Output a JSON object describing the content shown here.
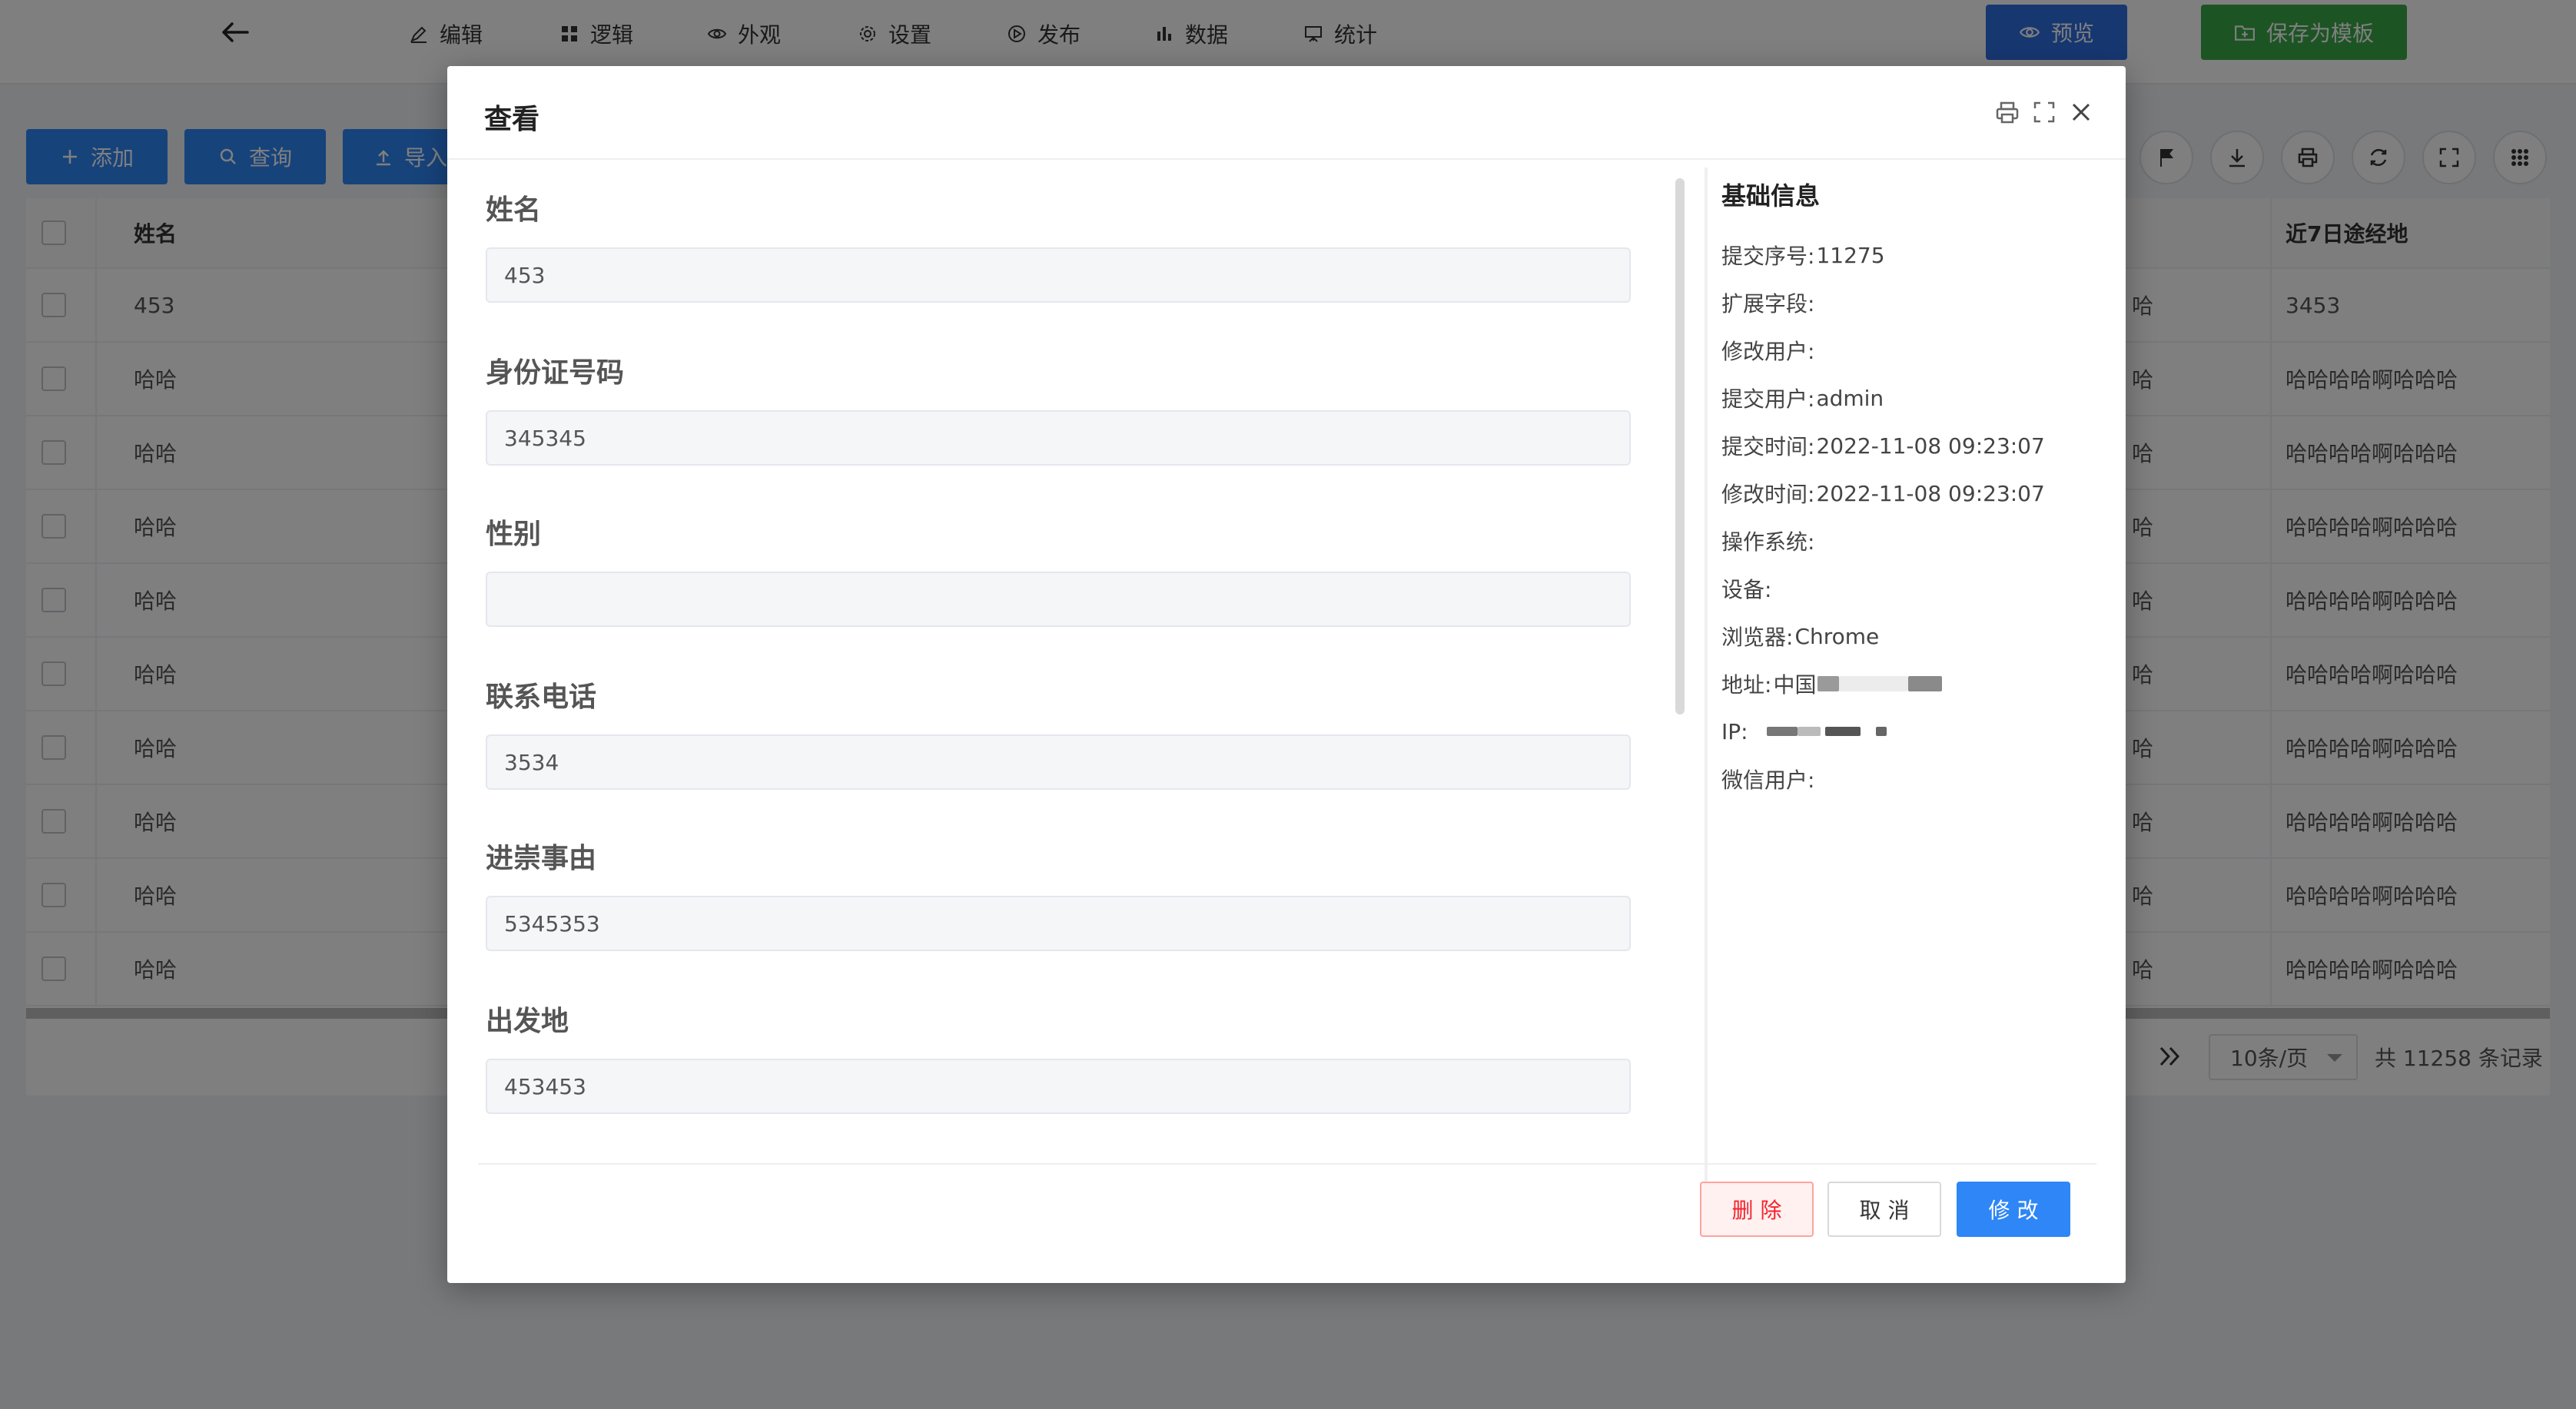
{
  "header": {
    "nav": [
      {
        "label": "编辑",
        "icon": "edit-icon"
      },
      {
        "label": "逻辑",
        "icon": "grid-icon"
      },
      {
        "label": "外观",
        "icon": "eye-icon"
      },
      {
        "label": "设置",
        "icon": "gear-icon"
      },
      {
        "label": "发布",
        "icon": "play-circle-icon"
      },
      {
        "label": "数据",
        "icon": "bar-chart-icon"
      },
      {
        "label": "统计",
        "icon": "board-icon"
      }
    ],
    "preview_label": "预览",
    "save_template_label": "保存为模板"
  },
  "list": {
    "add_label": "添加",
    "query_label": "查询",
    "import_label": "导入",
    "columns": {
      "name": "姓名",
      "last": "近7日途经地"
    },
    "rows": [
      {
        "name": "453",
        "last": "3453"
      },
      {
        "name": "哈哈",
        "last": "哈哈哈哈啊哈哈哈"
      },
      {
        "name": "哈哈",
        "last": "哈哈哈哈啊哈哈哈"
      },
      {
        "name": "哈哈",
        "last": "哈哈哈哈啊哈哈哈"
      },
      {
        "name": "哈哈",
        "last": "哈哈哈哈啊哈哈哈"
      },
      {
        "name": "哈哈",
        "last": "哈哈哈哈啊哈哈哈"
      },
      {
        "name": "哈哈",
        "last": "哈哈哈哈啊哈哈哈"
      },
      {
        "name": "哈哈",
        "last": "哈哈哈哈啊哈哈哈"
      },
      {
        "name": "哈哈",
        "last": "哈哈哈哈啊哈哈哈"
      },
      {
        "name": "哈哈",
        "last": "哈哈哈哈啊哈哈哈"
      }
    ],
    "partial_col_text": "哈",
    "page_size": "10条/页",
    "total": "共 11258 条记录"
  },
  "modal": {
    "title": "查看",
    "fields": [
      {
        "label": "姓名",
        "value": "453"
      },
      {
        "label": "身份证号码",
        "value": "345345"
      },
      {
        "label": "性别",
        "value": ""
      },
      {
        "label": "联系电话",
        "value": "3534"
      },
      {
        "label": "进崇事由",
        "value": "5345353"
      },
      {
        "label": "出发地",
        "value": "453453"
      }
    ],
    "info": {
      "title": "基础信息",
      "rows": [
        {
          "label": "提交序号:",
          "value": "11275"
        },
        {
          "label": "扩展字段:",
          "value": ""
        },
        {
          "label": "修改用户:",
          "value": ""
        },
        {
          "label": "提交用户:",
          "value": "admin"
        },
        {
          "label": "提交时间:",
          "value": "2022-11-08 09:23:07"
        },
        {
          "label": "修改时间:",
          "value": "2022-11-08 09:23:07"
        },
        {
          "label": "操作系统:",
          "value": ""
        },
        {
          "label": "设备:",
          "value": ""
        },
        {
          "label": "浏览器:",
          "value": "Chrome"
        },
        {
          "label": "地址:",
          "value": "中国"
        },
        {
          "label": "IP:",
          "value": ""
        },
        {
          "label": "微信用户:",
          "value": ""
        }
      ]
    },
    "delete_label": "删 除",
    "cancel_label": "取 消",
    "edit_label": "修 改"
  }
}
